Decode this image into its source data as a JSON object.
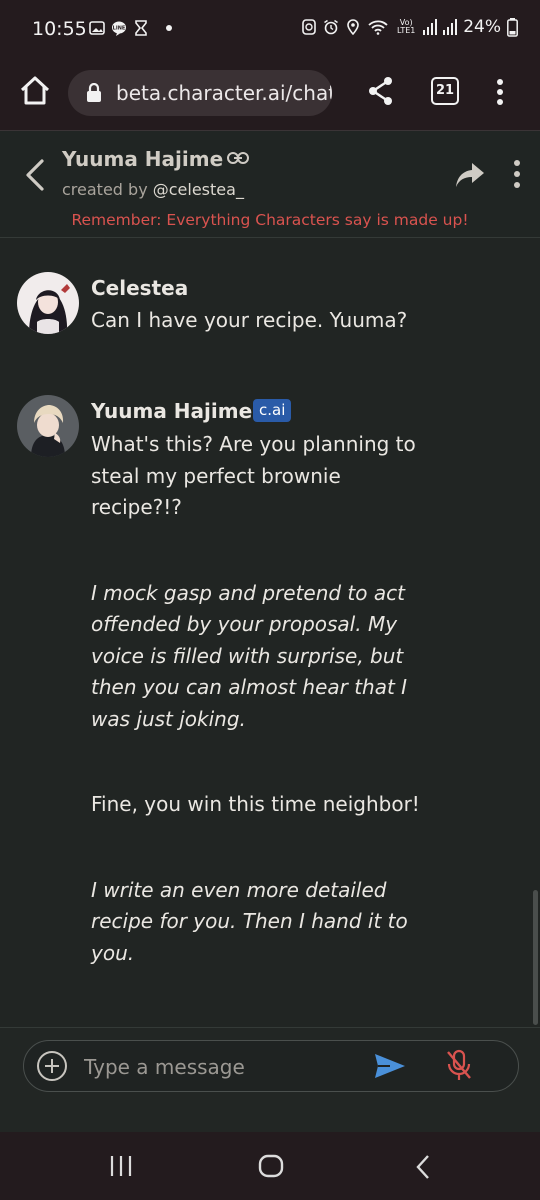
{
  "status_bar": {
    "time": "10:55",
    "battery": "24%",
    "network": "Vo) LTE1"
  },
  "browser": {
    "url": "beta.character.ai/chat",
    "tab_count": "21"
  },
  "chat_header": {
    "character_name": "Yuuma Hajime",
    "created_by_prefix": "created by",
    "creator_handle": "@celestea_",
    "disclaimer": "Remember: Everything Characters say is made up!"
  },
  "messages": [
    {
      "sender": "Celestea",
      "paragraphs": [
        {
          "text": "Can I have your recipe. Yuuma?",
          "italic": false
        }
      ]
    },
    {
      "sender": "Yuuma Hajime",
      "badge": "c.ai",
      "paragraphs": [
        {
          "text": "What's this? Are you planning to steal my perfect brownie recipe?!?",
          "italic": false
        },
        {
          "text": "I mock gasp and pretend to act offended by your proposal. My voice is filled with surprise, but then you can almost hear that I was just joking.",
          "italic": true
        },
        {
          "text": "Fine, you win this time neighbor!",
          "italic": false
        },
        {
          "text": "I write an even more detailed recipe for you. Then I hand it to you.",
          "italic": true
        }
      ]
    }
  ],
  "composer": {
    "placeholder": "Type a message"
  },
  "colors": {
    "background": "#212523",
    "disclaimer": "#d9534f",
    "badge": "#2a5ba8",
    "send": "#4a90d9",
    "mic_muted": "#d9534f"
  }
}
